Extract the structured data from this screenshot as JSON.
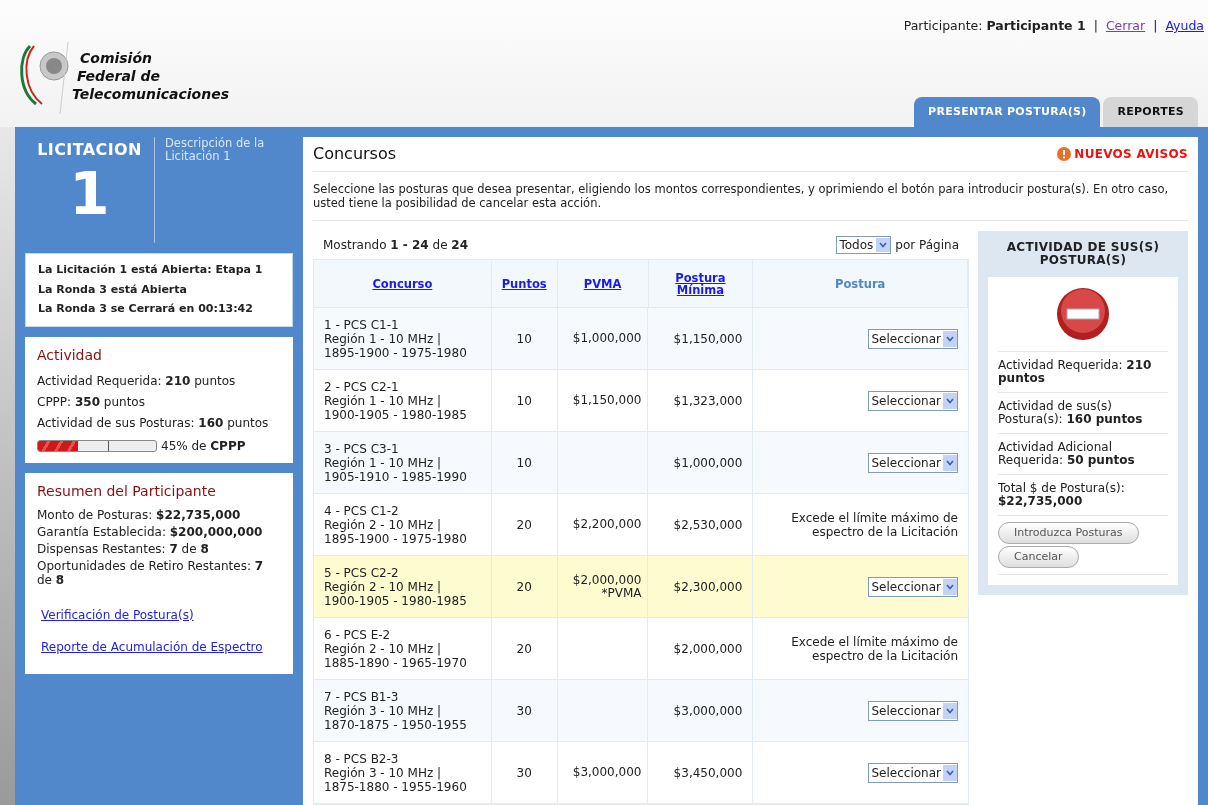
{
  "header": {
    "participant_label": "Participante:",
    "participant_name": "Participante 1",
    "separator_1": "|",
    "logout_link": "Cerrar",
    "separator_2": "|",
    "help_link": "Ayuda",
    "logo_lines": [
      "Comisión",
      "Federal de",
      "Telecomunicaciones"
    ]
  },
  "tabs": [
    {
      "label": "PRESENTAR POSTURA(S)",
      "selected": true
    },
    {
      "label": "REPORTES",
      "selected": false
    }
  ],
  "sidebar": {
    "licitacion_label": "LICITACION",
    "licitacion_number": "1",
    "description": "Descripción de la Licitación 1",
    "status_lines": [
      "La Licitación 1 está Abierta: Etapa 1",
      "La Ronda 3 está Abierta",
      "La Ronda 3 se Cerrará en 00:13:42"
    ],
    "activity": {
      "title": "Actividad",
      "lines": [
        "Actividad Requerida: **210** puntos",
        "CPPP: **350** puntos",
        "Actividad de sus Posturas: **160** puntos"
      ],
      "level": 0.34,
      "reading": "45% de **CPPP**"
    },
    "summary": {
      "title": "Resumen del Participante",
      "lines": [
        "Monto de Posturas: **$22,735,000**",
        "Garantía Establecida: **$200,000,000**",
        "Dispensas Restantes: **7** de **8**",
        "Oportunidades de Retiro Restantes: **7** de **8**"
      ],
      "links": [
        "Verificación de Postura(s)",
        "Reporte de Acumulación de Espectro"
      ]
    }
  },
  "main": {
    "title": "Concursos",
    "alert": "NUEVOS AVISOS",
    "instructions": "Seleccione las posturas que desea presentar, eligiendo los montos correspondientes, y oprimiendo el botón para introducir postura(s). En otro caso, usted tiene la posibilidad de cancelar esta acción.",
    "showing": "Mostrando **1 - 24** de **24**",
    "per_page_value": "Todos",
    "per_page_label": "por Página"
  },
  "table": {
    "columns": [
      {
        "label": "Concurso",
        "kind": "link"
      },
      {
        "label": "Puntos",
        "kind": "link"
      },
      {
        "label": "PVMA",
        "kind": "link"
      },
      {
        "label": "Postura Mínima",
        "kind": "link"
      },
      {
        "label": "Postura",
        "kind": "plain"
      }
    ],
    "rows": [
      {
        "concurso": [
          "1 - PCS C1-1",
          "Región 1 - 10 MHz |",
          "1895-1900 - 1975-1980"
        ],
        "puntos": "10",
        "pvma": "$1,000,000",
        "minima": "$1,150,000",
        "highlighted": false,
        "postura": {
          "kind": "select",
          "text": "Seleccionar"
        }
      },
      {
        "concurso": [
          "2 - PCS C2-1",
          "Región 1 - 10 MHz |",
          "1900-1905 - 1980-1985"
        ],
        "puntos": "10",
        "pvma": "$1,150,000",
        "minima": "$1,323,000",
        "highlighted": false,
        "postura": {
          "kind": "select",
          "text": "Seleccionar"
        }
      },
      {
        "concurso": [
          "3 - PCS C3-1",
          "Región 1 - 10 MHz |",
          "1905-1910 - 1985-1990"
        ],
        "puntos": "10",
        "minima": "$1,000,000",
        "highlighted": false,
        "postura": {
          "kind": "select",
          "text": "Seleccionar"
        }
      },
      {
        "concurso": [
          "4 - PCS C1-2",
          "Región 2 - 10 MHz |",
          "1895-1900 - 1975-1980"
        ],
        "puntos": "20",
        "pvma": "$2,200,000",
        "minima": "$2,530,000",
        "highlighted": false,
        "postura": {
          "kind": "message",
          "text": "Excede el límite máximo de espectro de la Licitación"
        }
      },
      {
        "concurso": [
          "5 - PCS C2-2",
          "Región 2 - 10 MHz |",
          "1900-1905 - 1980-1985"
        ],
        "puntos": "20",
        "pvma": "$2,000,000",
        "pvma_note": "*PVMA",
        "minima": "$2,300,000",
        "highlighted": true,
        "postura": {
          "kind": "select",
          "text": "Seleccionar"
        }
      },
      {
        "concurso": [
          "6 - PCS E-2",
          "Región 2 - 10 MHz |",
          "1885-1890 - 1965-1970"
        ],
        "puntos": "20",
        "minima": "$2,000,000",
        "highlighted": false,
        "postura": {
          "kind": "message",
          "text": "Excede el límite máximo de espectro de la Licitación"
        }
      },
      {
        "concurso": [
          "7 - PCS B1-3",
          "Región 3 - 10 MHz |",
          "1870-1875 - 1950-1955"
        ],
        "puntos": "30",
        "minima": "$3,000,000",
        "highlighted": false,
        "postura": {
          "kind": "select",
          "text": "Seleccionar"
        }
      },
      {
        "concurso": [
          "8 - PCS B2-3",
          "Región 3 - 10 MHz |",
          "1875-1880 - 1955-1960"
        ],
        "puntos": "30",
        "pvma": "$3,000,000",
        "minima": "$3,450,000",
        "highlighted": false,
        "postura": {
          "kind": "select",
          "text": "Seleccionar"
        }
      }
    ]
  },
  "activity_panel": {
    "title": "ACTIVIDAD DE SUS(S) POSTURA(S)",
    "items": [
      "Actividad Requerida: **210 puntos**",
      "Actividad de sus(s) Postura(s): **160 puntos**",
      "Actividad Adicional Requerida: **50 puntos**",
      "Total $ de Postura(s): **$22,735,000**"
    ],
    "buttons": [
      "Introduzca Posturas",
      "Cancelar"
    ]
  }
}
